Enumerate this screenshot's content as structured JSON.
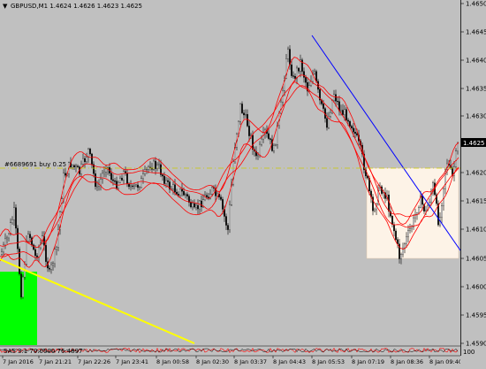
{
  "window": {
    "symbol_header": "GBPUSD,M1  1.4624 1.4626 1.4623 1.4625",
    "dropdown_glyph": "▼"
  },
  "price_axis": {
    "labels": [
      "1.4650",
      "1.4645",
      "1.4640",
      "1.4635",
      "1.4630",
      "1.4620",
      "1.4615",
      "1.4610",
      "1.4605",
      "1.4600",
      "1.4595",
      "1.4590"
    ],
    "current_price": "1.4625"
  },
  "time_axis": {
    "labels": [
      "7 Jan 2016",
      "7 Jan 21:21",
      "7 Jan 22:26",
      "7 Jan 23:41",
      "8 Jan 00:58",
      "8 Jan 02:30",
      "8 Jan 03:37",
      "8 Jan 04:43",
      "8 Jan 05:53",
      "8 Jan 07:19",
      "8 Jan 08:36",
      "8 Jan 09:40"
    ]
  },
  "order_line": {
    "label": "#6689691 buy 0.25"
  },
  "indicator": {
    "label": "SAS 3.1 70.0000 76.4897",
    "scale": "100"
  },
  "colors": {
    "background": "#c0c0c0",
    "candles": "#000000",
    "bands": "#ff0000",
    "trend_blue": "#0000ff",
    "trend_yellow": "#ffff00",
    "order_line": "#cccc00",
    "green_box": "#00ff00",
    "rect_fill": "#fdf3e7",
    "price_box": "#000000"
  }
}
